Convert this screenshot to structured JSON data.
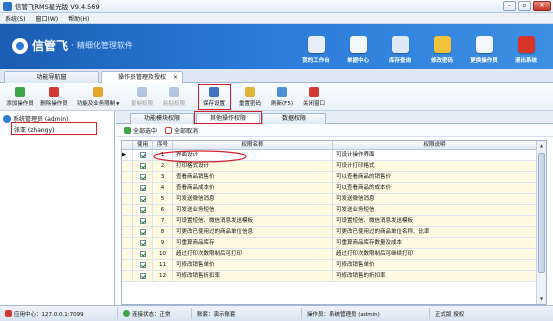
{
  "window": {
    "title": "信管飞RMS星光版 V9.4.569",
    "controls": {
      "minimize": "–",
      "restore": "▫",
      "close": "✕"
    }
  },
  "menu": [
    "系统(S)",
    "窗口(W)",
    "帮助(H)"
  ],
  "banner": {
    "brand": "信管飞",
    "separator": "·",
    "slogan": "精细化管理软件"
  },
  "topnav": [
    {
      "label": "我的工作台",
      "icon": "monitor-icon",
      "color": "#e8eef8"
    },
    {
      "label": "单据中心",
      "icon": "documents-icon",
      "color": "#f3f6fb"
    },
    {
      "label": "库存查询",
      "icon": "warehouse-icon",
      "color": "#dfe9f6"
    },
    {
      "label": "修改密码",
      "icon": "lock-icon",
      "color": "#f2c23a"
    },
    {
      "label": "更换操作员",
      "icon": "users-icon",
      "color": "#f3f6fb"
    },
    {
      "label": "退出系统",
      "icon": "exit-icon",
      "color": "#d9342a"
    }
  ],
  "tabs": {
    "nav": "功能导航窗",
    "active": "操作员管理及授权",
    "close": "×"
  },
  "toolbar": [
    {
      "label": "添加操作员",
      "icon": "add-user-icon",
      "color": "#3ea548",
      "enabled": true,
      "dropdown": false
    },
    {
      "label": "删除操作员",
      "icon": "delete-user-icon",
      "color": "#d23b33",
      "enabled": true,
      "dropdown": false
    },
    {
      "label": "功能及业务限制",
      "icon": "restrict-icon",
      "color": "#e8a62a",
      "enabled": true,
      "dropdown": true
    },
    {
      "label": "复制权限",
      "icon": "copy-icon",
      "color": "#5d86c2",
      "enabled": false,
      "dropdown": false
    },
    {
      "label": "粘贴权限",
      "icon": "paste-icon",
      "color": "#5d86c2",
      "enabled": false,
      "dropdown": false
    },
    {
      "label": "保存设置",
      "icon": "save-icon",
      "color": "#3f72c0",
      "enabled": true,
      "dropdown": false
    },
    {
      "label": "重置密码",
      "icon": "reset-password-icon",
      "color": "#e2b53a",
      "enabled": true,
      "dropdown": false
    },
    {
      "label": "刷新(F5)",
      "icon": "refresh-icon",
      "color": "#4a8fd6",
      "enabled": true,
      "dropdown": false
    },
    {
      "label": "关闭窗口",
      "icon": "close-window-icon",
      "color": "#d23b33",
      "enabled": true,
      "dropdown": false
    }
  ],
  "tree": [
    {
      "label": "系统管理员 (admin)",
      "icon": "admin-user-icon",
      "color": "#2e7bd1"
    },
    {
      "label": "张亚 (zhangy)",
      "icon": "user-icon",
      "color": "#6aa5e0"
    }
  ],
  "subtabs": [
    "功能模块权限",
    "其他操作权限",
    "数据权限"
  ],
  "selection": {
    "select_all": "全部选中",
    "deselect_all": "全部取消"
  },
  "grid": {
    "headers": [
      "",
      "使用",
      "序号",
      "权限名称",
      "权限说明"
    ],
    "rows": [
      {
        "no": "1",
        "name": "界面设计",
        "desc": "可设计操作界面",
        "checked": true
      },
      {
        "no": "2",
        "name": "打印格式设计",
        "desc": "可设计打印格式",
        "checked": true
      },
      {
        "no": "3",
        "name": "查看商品销售价",
        "desc": "可以查看商品的销售价",
        "checked": true
      },
      {
        "no": "4",
        "name": "查看商品成本价",
        "desc": "可以查看商品的成本价",
        "checked": true
      },
      {
        "no": "5",
        "name": "可发送微信消息",
        "desc": "可发送微信消息",
        "checked": true
      },
      {
        "no": "6",
        "name": "可发送业务短信",
        "desc": "可发送业务短信",
        "checked": true
      },
      {
        "no": "7",
        "name": "可设置短信、微信消息发送模板",
        "desc": "可设置短信、微信消息发送模板",
        "checked": true
      },
      {
        "no": "8",
        "name": "可更改已使用过的商品单位信息",
        "desc": "可更改已使用过的商品单位名称、比率",
        "checked": true
      },
      {
        "no": "9",
        "name": "可重算商品库存",
        "desc": "可重算商品库存数量及成本",
        "checked": true
      },
      {
        "no": "10",
        "name": "超过打印次数限制后可打印",
        "desc": "超过打印次数限制后可继续打印",
        "checked": true
      },
      {
        "no": "11",
        "name": "可修改销售单价",
        "desc": "可修改销售单价",
        "checked": true
      },
      {
        "no": "12",
        "name": "可修改销售折扣率",
        "desc": "可修改销售的折扣率",
        "checked": true
      }
    ],
    "scroll": {
      "up": "▲",
      "down": "▼"
    }
  },
  "status": [
    {
      "label": "应用中心：127.0.0.1:7099",
      "icon": "app-center-icon",
      "color": "#d23b33"
    },
    {
      "label": "连接状态：正常",
      "icon": "connection-icon",
      "color": "#3ea548"
    },
    {
      "label": "账套：演示账套",
      "icon": "",
      "color": ""
    },
    {
      "label": "操作员：系统管理员 (admin)",
      "icon": "",
      "color": ""
    },
    {
      "label": "正式版 授权",
      "icon": "",
      "color": ""
    }
  ]
}
